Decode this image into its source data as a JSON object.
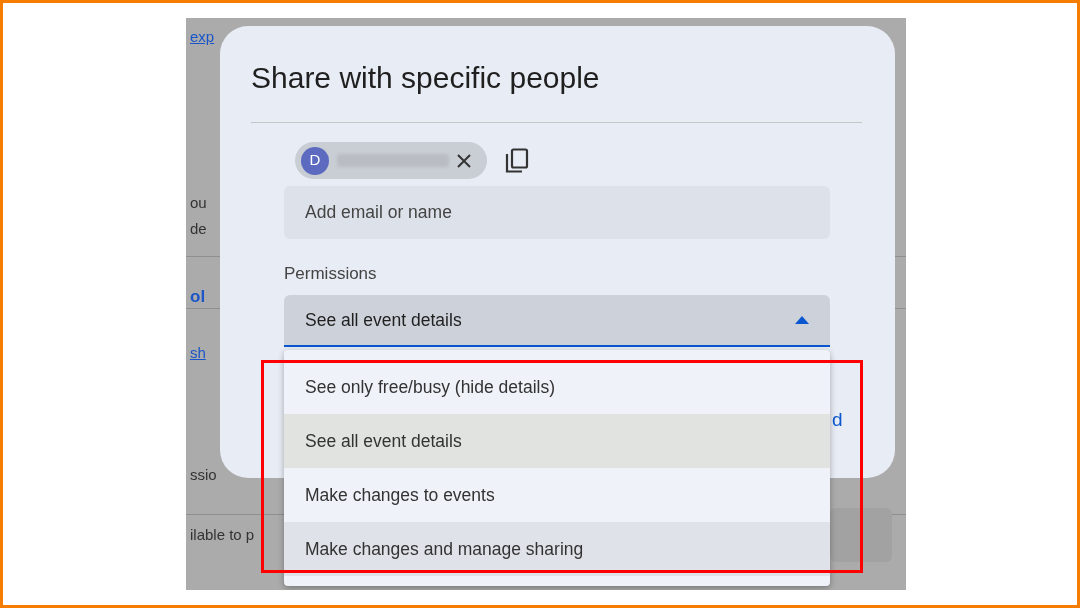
{
  "background_page": {
    "fragments": [
      {
        "text": "exp",
        "kind": "link"
      },
      {
        "text": "ou",
        "kind": "text"
      },
      {
        "text": "de",
        "kind": "text"
      },
      {
        "text": "ol",
        "kind": "heading"
      },
      {
        "text": "sh",
        "kind": "link"
      },
      {
        "text": "ssio",
        "kind": "text"
      },
      {
        "text": "ilable to p",
        "kind": "text"
      }
    ]
  },
  "dialog": {
    "title": "Share with specific people",
    "people": [
      {
        "initial": "D"
      }
    ],
    "add_field": {
      "placeholder": "Add email or name"
    },
    "permissions": {
      "label": "Permissions",
      "value": "See all event details",
      "expanded": true,
      "options": [
        {
          "label": "See only free/busy (hide details)",
          "selected": false,
          "hovered": false
        },
        {
          "label": "See all event details",
          "selected": true,
          "hovered": false
        },
        {
          "label": "Make changes to events",
          "selected": false,
          "hovered": false
        },
        {
          "label": "Make changes and manage sharing",
          "selected": false,
          "hovered": true
        }
      ]
    },
    "button_fragment": "d"
  },
  "highlight": {
    "shown": true
  }
}
